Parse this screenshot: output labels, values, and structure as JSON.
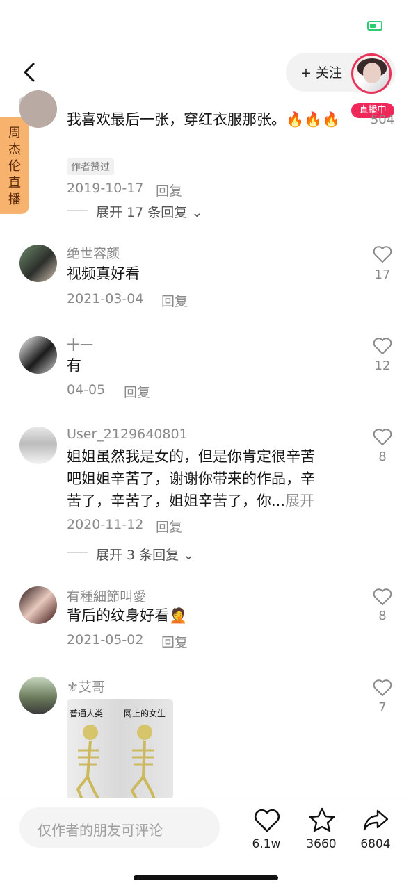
{
  "status": {
    "battery_color": "#2ecc71"
  },
  "header": {
    "back_icon": "chevron-left-icon",
    "follow_label": "+ 关注",
    "live_badge": "直播中"
  },
  "live_tab": {
    "label": "周杰伦直播"
  },
  "comments": [
    {
      "comment": "我喜欢最后一张，穿红衣服那张。🔥🔥🔥",
      "author_tag": "作者赞过",
      "date": "2019-10-17",
      "reply": "回复",
      "likes": "504",
      "expand": "展开 17 条回复"
    },
    {
      "username": "绝世容颜",
      "comment": "视频真好看",
      "date": "2021-03-04",
      "reply": "回复",
      "likes": "17"
    },
    {
      "username": "十一",
      "comment": "有",
      "date": "04-05",
      "reply": "回复",
      "likes": "12"
    },
    {
      "username": "User_2129640801",
      "comment_line1": "姐姐虽然我是女的，但是你肯定很辛苦",
      "comment_line2": "吧姐姐辛苦了，谢谢你带来的作品，辛",
      "comment_line3": "苦了，辛苦了，姐姐辛苦了，你...",
      "more": "展开",
      "date": "2020-11-12",
      "reply": "回复",
      "likes": "8",
      "expand": "展开 3 条回复"
    },
    {
      "username": "有種細節叫愛",
      "comment": "背后的纹身好看🤦",
      "date": "2021-05-02",
      "reply": "回复",
      "likes": "8"
    },
    {
      "username": "⚜艾哥",
      "likes": "7",
      "meme_left": "普通人类",
      "meme_right": "网上的女生"
    }
  ],
  "bottom": {
    "input_placeholder": "仅作者的朋友可评论",
    "likes": "6.1w",
    "favorites": "3660",
    "shares": "6804"
  }
}
